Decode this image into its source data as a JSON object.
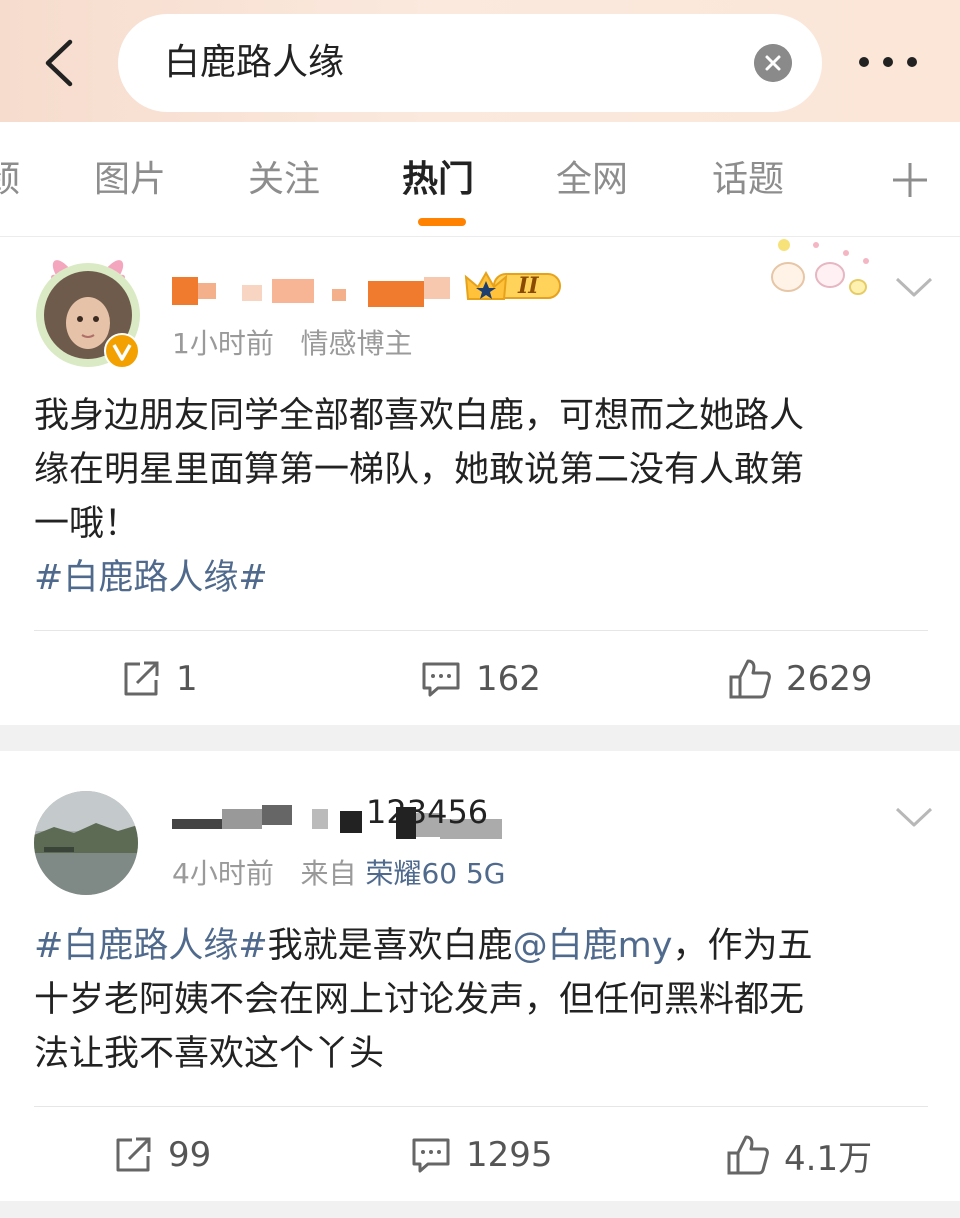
{
  "search": {
    "query": "白鹿路人缘"
  },
  "tabs": [
    {
      "label": "颈"
    },
    {
      "label": "图片"
    },
    {
      "label": "关注"
    },
    {
      "label": "热门",
      "active": true
    },
    {
      "label": "全网"
    },
    {
      "label": "话题"
    }
  ],
  "posts": [
    {
      "badge_level": "II",
      "time": "1小时前",
      "tag": "情感博主",
      "content_lines": [
        "我身边朋友同学全部都喜欢白鹿，可想而之她路人",
        "缘在明星里面算第一梯队，她敢说第二没有人敢第",
        "一哦！"
      ],
      "topic": "#白鹿路人缘#",
      "reposts": "1",
      "comments": "162",
      "likes": "2629"
    },
    {
      "username_fragment": "123456",
      "time": "4小时前",
      "source_label": "来自",
      "source_device": "荣耀60 5G",
      "topic": "#白鹿路人缘#",
      "content_after_topic": "我就是喜欢白鹿",
      "mention": "@白鹿my",
      "content_rest": "，作为五",
      "content_lines": [
        "十岁老阿姨不会在网上讨论发声，但任何黑料都无",
        "法让我不喜欢这个丫头"
      ],
      "reposts": "99",
      "comments": "1295",
      "likes": "4.1万"
    }
  ],
  "colors": {
    "accent": "#ff8200",
    "link": "#4f6a8c",
    "verified": "#f2a100"
  }
}
